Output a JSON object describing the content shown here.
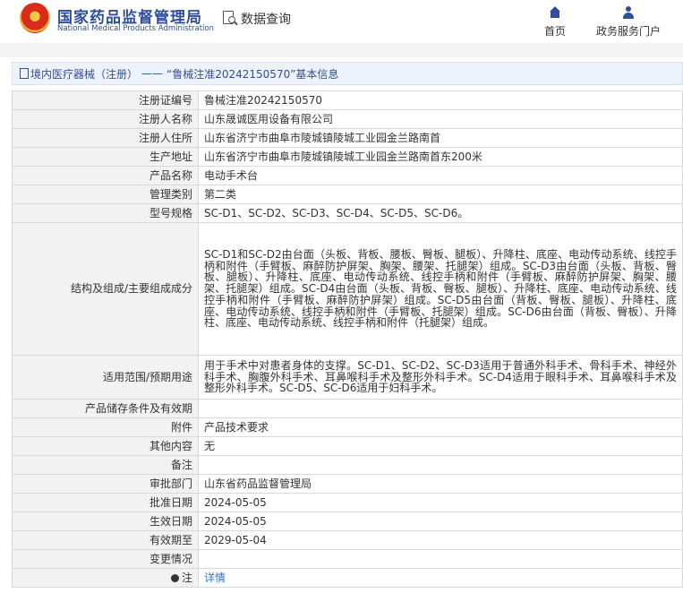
{
  "header": {
    "site_name_cn": "国家药品监督管理局",
    "site_name_en": "National Medical Products Administration",
    "data_query": "数据查询",
    "nav": [
      {
        "label": "首页",
        "icon": "home-icon"
      },
      {
        "label": "政务服务门户",
        "icon": "user-icon"
      }
    ]
  },
  "breadcrumb": {
    "category": "境内医疗器械（注册）",
    "separator": "——",
    "title": "“鲁械注准20242150570”基本信息"
  },
  "rows": [
    {
      "label": "注册证编号",
      "value": "鲁械注准20242150570"
    },
    {
      "label": "注册人名称",
      "value": "山东晟诚医用设备有限公司"
    },
    {
      "label": "注册人住所",
      "value": "山东省济宁市曲阜市陵城镇陵城工业园金兰路南首"
    },
    {
      "label": "生产地址",
      "value": "山东省济宁市曲阜市陵城镇陵城工业园金兰路南首东200米"
    },
    {
      "label": "产品名称",
      "value": "电动手术台"
    },
    {
      "label": "管理类别",
      "value": "第二类"
    },
    {
      "label": "型号规格",
      "value": "SC-D1、SC-D2、SC-D3、SC-D4、SC-D5、SC-D6。"
    },
    {
      "label": "结构及组成/主要组成成分",
      "value": "SC-D1和SC-D2由台面（头板、背板、腰板、臀板、腿板）、升降柱、底座、电动传动系统、线控手柄和附件（手臂板、麻醉防护屏架、胸架、腰架、托腿架）组成。SC-D3由台面（头板、背板、臀板、腿板）、升降柱、底座、电动传动系统、线控手柄和附件（手臂板、麻醉防护屏架、胸架、腰架、托腿架）组成。SC-D4由台面（头板、背板、臀板、腿板）、升降柱、底座、电动传动系统、线控手柄和附件（手臂板、麻醉防护屏架）组成。SC-D5由台面（背板、臀板、腿板）、升降柱、底座、电动传动系统、线控手柄和附件（手臂板、托腿架）组成。SC-D6由台面（背板、臀板）、升降柱、底座、电动传动系统、线控手柄和附件（托腿架）组成。"
    },
    {
      "label": "适用范围/预期用途",
      "value": "用于手术中对患者身体的支撑。SC-D1、SC-D2、SC-D3适用于普通外科手术、骨科手术、神经外科手术、胸腹外科手术、耳鼻喉科手术及整形外科手术。SC-D4适用于眼科手术、耳鼻喉科手术及整形外科手术。SC-D5、SC-D6适用于妇科手术。"
    },
    {
      "label": "产品储存条件及有效期",
      "value": ""
    },
    {
      "label": "附件",
      "value": "产品技术要求"
    },
    {
      "label": "其他内容",
      "value": "无"
    },
    {
      "label": "备注",
      "value": ""
    },
    {
      "label": "审批部门",
      "value": "山东省药品监督管理局"
    },
    {
      "label": "批准日期",
      "value": "2024-05-05"
    },
    {
      "label": "生效日期",
      "value": "2024-05-05"
    },
    {
      "label": "有效期至",
      "value": "2029-05-04"
    },
    {
      "label": "变更情况",
      "value": ""
    }
  ],
  "note": {
    "label": "注",
    "link": "详情"
  }
}
